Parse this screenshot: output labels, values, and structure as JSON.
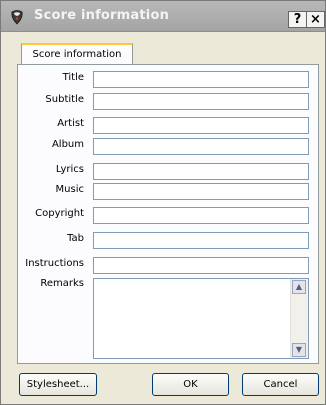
{
  "window": {
    "title": "Score information",
    "help_label": "?",
    "close_label": "×",
    "icon": "guitar-pick-icon"
  },
  "tabs": [
    {
      "label": "Score information",
      "selected": true
    }
  ],
  "form": {
    "labels": {
      "title": "Title",
      "subtitle": "Subtitle",
      "artist": "Artist",
      "album": "Album",
      "lyrics": "Lyrics",
      "music": "Music",
      "copyright": "Copyright",
      "tab": "Tab",
      "instructions": "Instructions",
      "remarks": "Remarks"
    },
    "values": {
      "title": "",
      "subtitle": "",
      "artist": "",
      "album": "",
      "lyrics": "",
      "music": "",
      "copyright": "",
      "tab": "",
      "instructions": "",
      "remarks": ""
    }
  },
  "scrollbar": {
    "up_glyph": "▲",
    "down_glyph": "▼"
  },
  "buttons": {
    "stylesheet": "Stylesheet...",
    "ok": "OK",
    "cancel": "Cancel"
  }
}
